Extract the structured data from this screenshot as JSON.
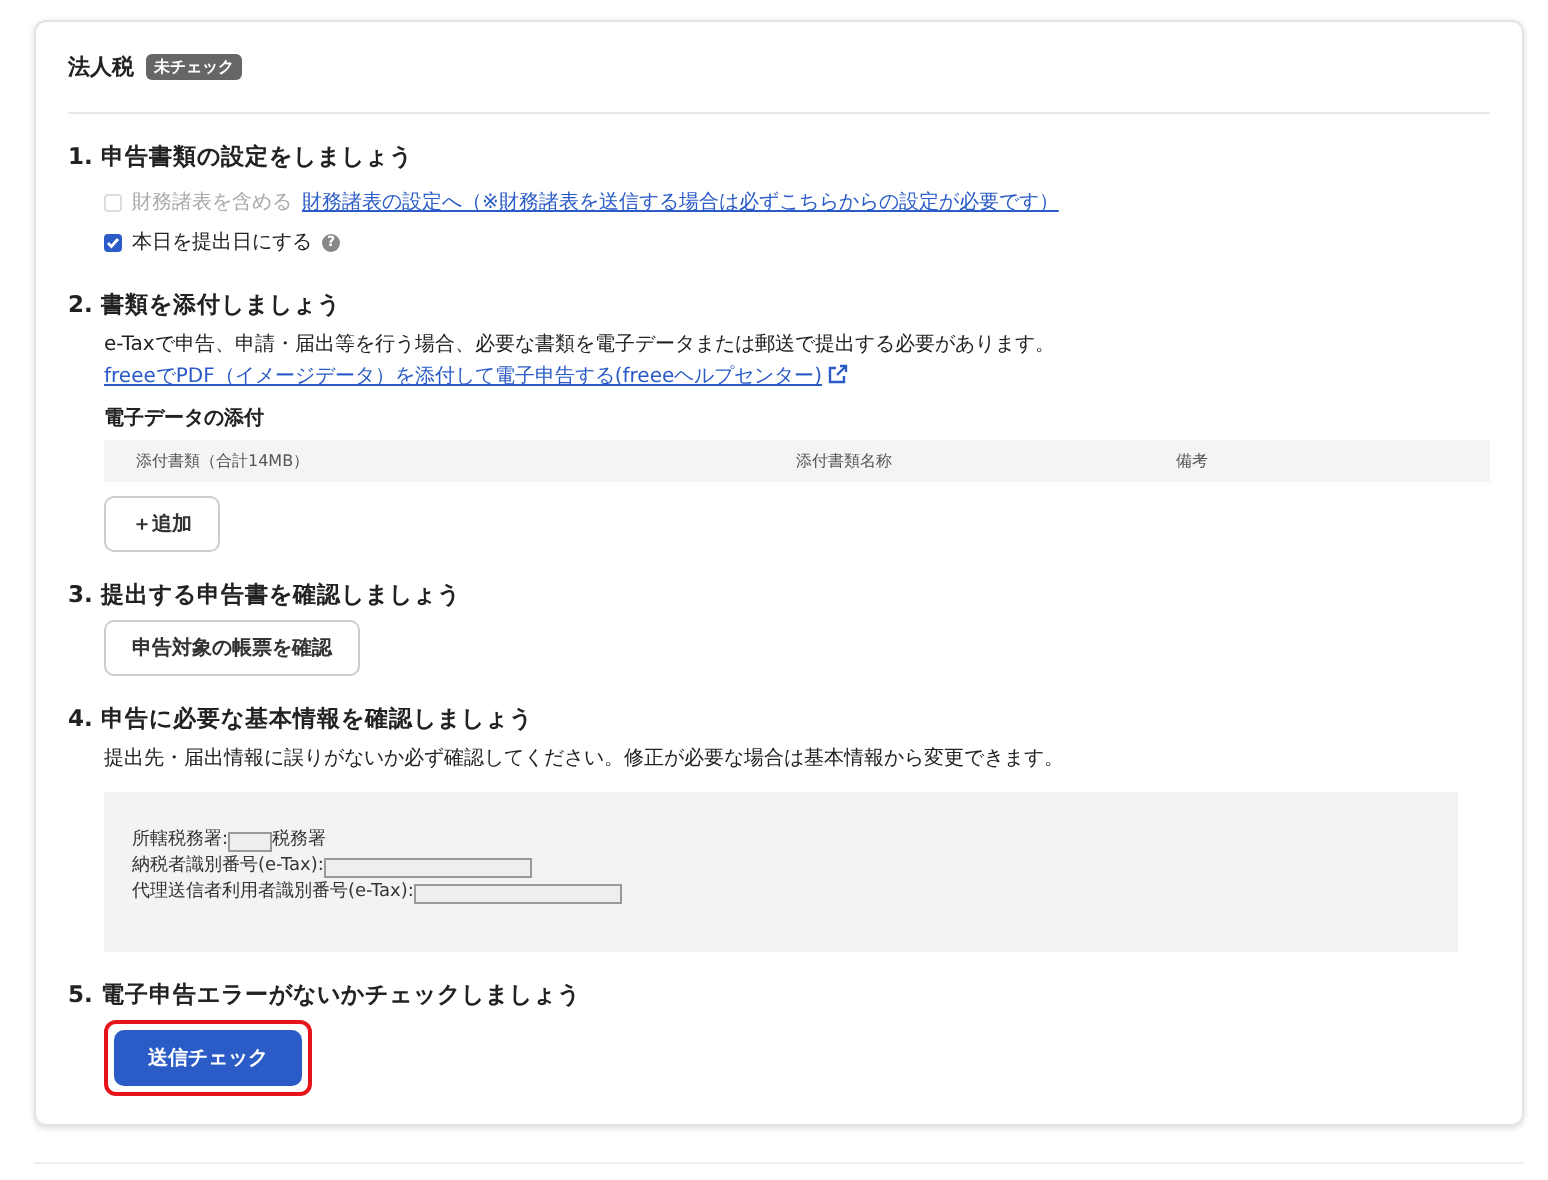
{
  "header": {
    "title": "法人税",
    "badge": "未チェック"
  },
  "sections": [
    {
      "kind": "settings",
      "title": "1. 申告書類の設定をしましょう",
      "options": [
        {
          "label": "財務諸表を含める",
          "checked": false,
          "disabled": true,
          "link": "財務諸表の設定へ（※財務諸表を送信する場合は必ずこちらからの設定が必要です）"
        },
        {
          "label": "本日を提出日にする",
          "checked": true,
          "disabled": false,
          "help": "?"
        }
      ]
    },
    {
      "kind": "attach",
      "title": "2. 書類を添付しましょう",
      "description": "e-Taxで申告、申請・届出等を行う場合、必要な書類を電子データまたは郵送で提出する必要があります。",
      "link": "freeeでPDF（イメージデータ）を添付して電子申告する(freeeヘルプセンター)",
      "subheading": "電子データの添付",
      "columns": [
        "添付書類（合計14MB）",
        "添付書類名称",
        "備考"
      ],
      "add_button": "＋追加"
    },
    {
      "kind": "confirm",
      "title": "3. 提出する申告書を確認しましょう",
      "button": "申告対象の帳票を確認"
    },
    {
      "kind": "info",
      "title": "4. 申告に必要な基本情報を確認しましょう",
      "description": "提出先・届出情報に誤りがないか必ず確認してください。修正が必要な場合は基本情報から変更できます。",
      "fields": [
        {
          "label": "所轄税務署:",
          "suffix": "税務署"
        },
        {
          "label": "納税者識別番号(e-Tax):"
        },
        {
          "label": "代理送信者利用者識別番号(e-Tax):"
        }
      ]
    },
    {
      "kind": "check",
      "title": "5. 電子申告エラーがないかチェックしましょう",
      "button": "送信チェック",
      "highlighted": true
    }
  ]
}
